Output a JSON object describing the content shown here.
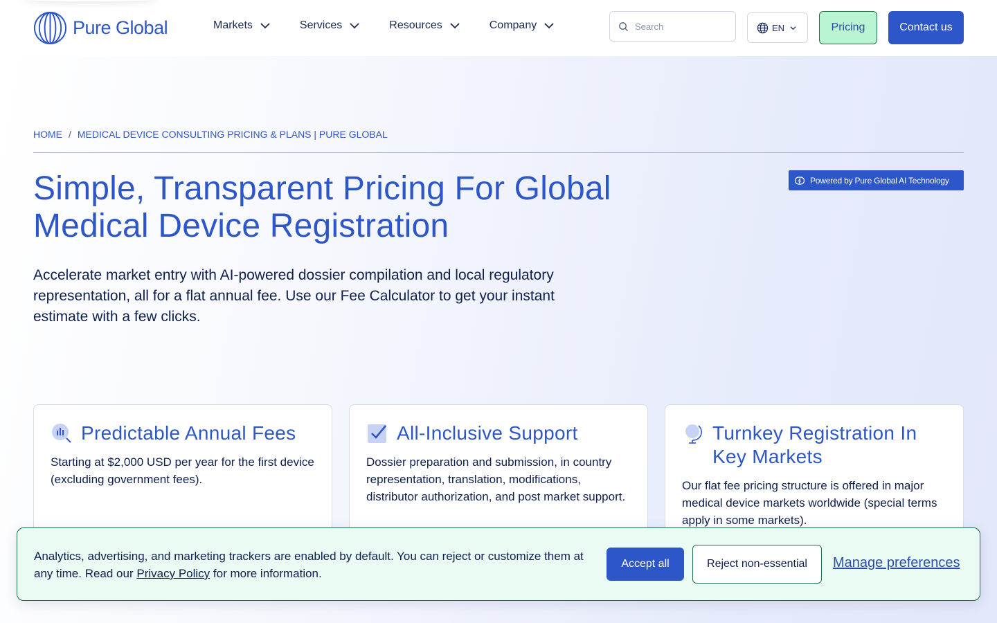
{
  "header": {
    "logo_text": "Pure Global",
    "nav": [
      {
        "label": "Markets"
      },
      {
        "label": "Services"
      },
      {
        "label": "Resources"
      },
      {
        "label": "Company"
      }
    ],
    "search_placeholder": "Search",
    "language": "EN",
    "pricing_label": "Pricing",
    "contact_label": "Contact us"
  },
  "breadcrumb": {
    "home": "HOME",
    "separator": "/",
    "current": "MEDICAL DEVICE CONSULTING PRICING & PLANS | PURE GLOBAL"
  },
  "hero": {
    "badge": "Powered by Pure Global AI Technology",
    "title": "Simple, Transparent Pricing For Global Medical Device Registration",
    "lead": "Accelerate market entry with AI-powered dossier compilation and local regulatory representation, all for a flat annual fee. Use our Fee Calculator to get your instant estimate with a few clicks."
  },
  "cards": [
    {
      "icon": "chart-magnifier-icon",
      "title": "Predictable Annual Fees",
      "text": "Starting at $2,000 USD per year for the first device (excluding government fees)."
    },
    {
      "icon": "checkbox-icon",
      "title": "All-Inclusive Support",
      "text": "Dossier preparation and submission, in country representation, translation, modifications, distributor authorization, and post market support."
    },
    {
      "icon": "globe-stand-icon",
      "title": "Turnkey Registration In Key Markets",
      "text": "Our flat fee pricing structure is offered in major medical device markets worldwide (special terms apply in some markets)."
    }
  ],
  "cookie": {
    "text_before": "Analytics, advertising, and marketing trackers are enabled by default. You can reject or customize them at any time. Read our ",
    "link": "Privacy Policy",
    "text_after": " for more information.",
    "accept_label": "Accept all",
    "reject_label": "Reject non-essential",
    "manage_label": "Manage preferences"
  },
  "colors": {
    "brand_blue": "#2d56c9",
    "mint": "#b9f5d3",
    "banner_bg": "#e9fbf2",
    "text_dark": "#0f1f4d"
  }
}
